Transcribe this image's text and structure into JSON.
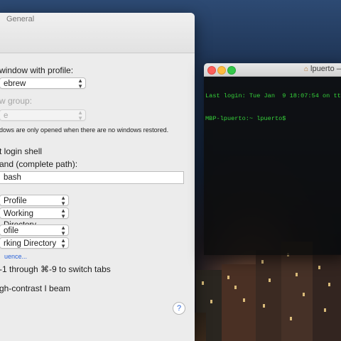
{
  "preferences": {
    "toolbar_tab": "General",
    "new_window_label": "window with profile:",
    "new_window_value": "ebrew",
    "new_tab_label": "w group:",
    "new_tab_value": "e",
    "restore_note": "dows are only opened when there are no windows restored.",
    "shells_open_label": "t login shell",
    "command_label": "and (complete path):",
    "command_value": "bash",
    "profile_select_1": "Profile",
    "dir_select_1": "Working Directory",
    "profile_select_2": "ofile",
    "dir_select_2": "rking Directory",
    "sequence_link": "uence...",
    "switch_tabs_label": "-1 through ⌘-9 to switch tabs",
    "ibeam_label": "gh-contrast I beam",
    "help_button": "?"
  },
  "terminal": {
    "title": "lpuerto —",
    "lines": [
      "Last login: Tue Jan  9 18:07:54 on tt",
      "MBP-lpuerto:~ lpuerto$"
    ]
  },
  "colors": {
    "terminal_text": "#35d23a",
    "link": "#2b63d8"
  }
}
